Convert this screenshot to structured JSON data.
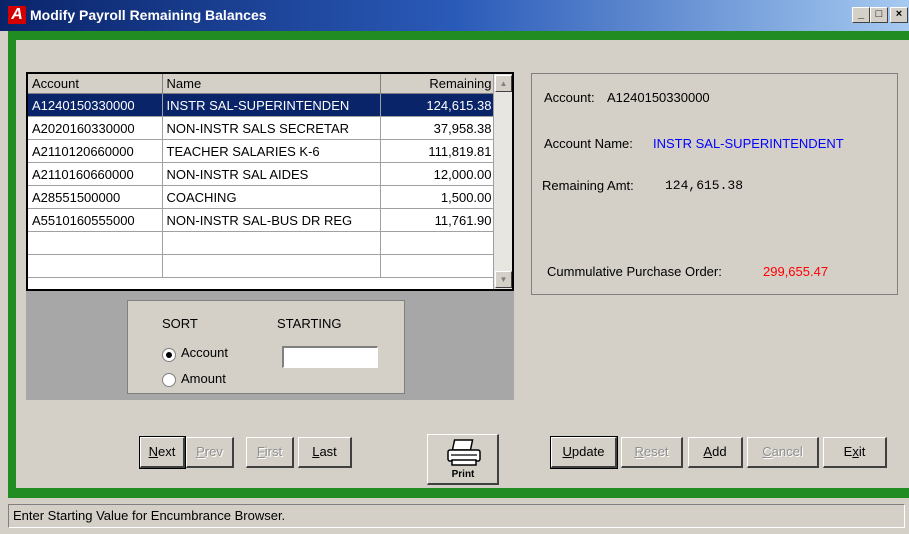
{
  "window": {
    "title": "Modify Payroll Remaining Balances",
    "app_icon_letter": "A"
  },
  "title_buttons": [
    "_",
    "□",
    "×"
  ],
  "grid": {
    "columns": [
      "Account",
      "Name",
      "Remaining"
    ],
    "rows": [
      {
        "account": "A1240150330000",
        "name": "INSTR SAL-SUPERINTENDEN",
        "remaining": "124,615.38",
        "selected": true
      },
      {
        "account": "A2020160330000",
        "name": "NON-INSTR SALS SECRETAR",
        "remaining": "37,958.38"
      },
      {
        "account": "A2110120660000",
        "name": "TEACHER SALARIES K-6",
        "remaining": "111,819.81"
      },
      {
        "account": "A2110160660000",
        "name": "NON-INSTR SAL AIDES",
        "remaining": "12,000.00"
      },
      {
        "account": "A28551500000",
        "name": "COACHING",
        "remaining": "1,500.00"
      },
      {
        "account": "A5510160555000",
        "name": "NON-INSTR SAL-BUS DR REG",
        "remaining": "11,761.90"
      },
      {
        "account": "",
        "name": "",
        "remaining": ""
      },
      {
        "account": "",
        "name": "",
        "remaining": ""
      }
    ]
  },
  "sort": {
    "sort_label": "SORT",
    "starting_label": "STARTING",
    "option_account": "Account",
    "option_amount": "Amount",
    "selected": "Account",
    "starting_value": ""
  },
  "details": {
    "account_label": "Account:",
    "account_value": "A1240150330000",
    "name_label": "Account Name:",
    "name_value": "INSTR SAL-SUPERINTENDENT",
    "remaining_label": "Remaining Amt:",
    "remaining_value": "124,615.38",
    "po_label": "Cummulative Purchase Order:",
    "po_value": "299,655.47",
    "name_color": "#0000ff",
    "po_color": "#ff0000"
  },
  "nav_buttons": {
    "next": {
      "u": "N",
      "rest": "ext"
    },
    "prev": {
      "u": "P",
      "rest": "rev"
    },
    "first": {
      "u": "F",
      "rest": "irst"
    },
    "last": {
      "u": "L",
      "rest": "ast"
    }
  },
  "print_label": "Print",
  "action_buttons": {
    "update": {
      "u": "U",
      "rest": "pdate"
    },
    "reset": {
      "u": "R",
      "rest": "eset"
    },
    "add": {
      "u": "A",
      "rest": "dd"
    },
    "cancel": {
      "u": "C",
      "rest": "ancel"
    },
    "exit": {
      "pre": "E",
      "u": "x",
      "rest": "it"
    }
  },
  "status_text": "Enter Starting Value for Encumbrance Browser.",
  "colors": {
    "title_bar": "#0a246a",
    "frame_green": "#218c21",
    "selection": "#0a246a"
  }
}
